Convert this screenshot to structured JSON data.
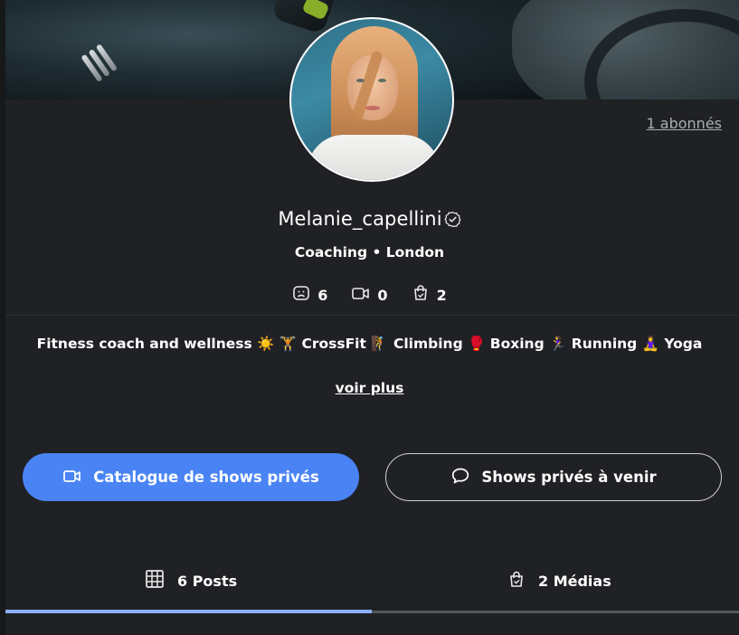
{
  "profile": {
    "followers_link": "1 abonnés",
    "username": "Melanie_capellini",
    "tagline": "Coaching • London",
    "bio": "Fitness coach and wellness ☀️ 🏋️ CrossFit 🧗 Climbing 🥊 Boxing 🏃‍♀️ Running 🧘‍♀️ Yoga",
    "see_more": "voir plus"
  },
  "counts": [
    {
      "icon": "face-icon",
      "value": "6"
    },
    {
      "icon": "video-camera-icon",
      "value": "0"
    },
    {
      "icon": "shopping-bag-icon",
      "value": "2"
    }
  ],
  "actions": {
    "catalog_label": "Catalogue de shows privés",
    "upcoming_label": "Shows privés à venir"
  },
  "tabs": [
    {
      "label": "6 Posts",
      "icon": "grid-icon",
      "active": true
    },
    {
      "label": "2 Médias",
      "icon": "shopping-bag-icon",
      "active": false
    }
  ],
  "colors": {
    "background": "#202124",
    "primary_button": "#4a84f4",
    "active_tab_underline": "#8ab0f6",
    "muted_link": "#a9acb0"
  }
}
